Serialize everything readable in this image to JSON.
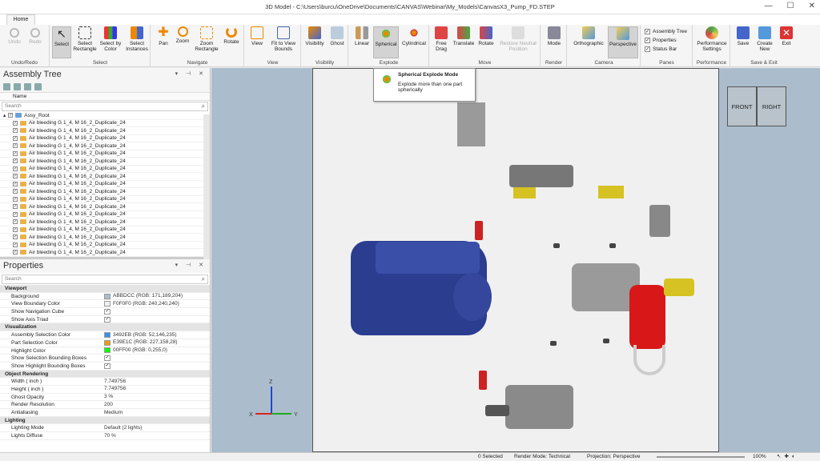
{
  "window": {
    "title": "3D Model - C:\\Users\\burcu\\OneDrive\\Documents\\CANVAS\\Webinar\\My_Models\\CanvasX3_Pump_FD.STEP"
  },
  "tab": "Home",
  "ribbon": {
    "undo": "Undo",
    "redo": "Redo",
    "undo_group": "Undo/Redo",
    "select": "Select",
    "select_rect": "Select Rectangle",
    "select_color": "Select by Color",
    "select_inst": "Select Instances",
    "select_group": "Select",
    "pan": "Pan",
    "zoom": "Zoom",
    "zoom_rect": "Zoom Rectangle",
    "rotate": "Rotate",
    "navigate_group": "Navigate",
    "view": "View",
    "fit": "Fit to View Bounds",
    "view_group": "View",
    "visibility": "Visibility",
    "ghost": "Ghost",
    "visibility_group": "Visibility",
    "linear": "Linear",
    "spherical": "Spherical",
    "cylindrical": "Cylindrical",
    "explode_group": "Explode",
    "free_drag": "Free Drag",
    "translate": "Translate",
    "rotate_move": "Rotate",
    "restore": "Restore Neutral Position",
    "move_group": "Move",
    "mode": "Mode",
    "render_group": "Render",
    "ortho": "Orthographic",
    "persp": "Perspective",
    "camera_group": "Camera",
    "assembly_tree": "Assembly Tree",
    "properties": "Properties",
    "status_bar": "Status Bar",
    "panes_group": "Panes",
    "perf": "Performance Settings",
    "perf_group": "Performance",
    "save": "Save",
    "create_new": "Create New",
    "exit": "Exit",
    "save_group": "Save & Exit"
  },
  "tooltip": {
    "title": "Spherical Explode Mode",
    "body": "Explode more than one part spherically"
  },
  "assembly": {
    "title": "Assembly Tree",
    "col_name": "Name",
    "search": "Search",
    "root": "Assy_Root",
    "item": "Air bleeding G 1_4, M 16_2_Duplicate_24"
  },
  "properties": {
    "title": "Properties",
    "search": "Search",
    "rows": [
      {
        "cat": true,
        "k": "Viewport",
        "v": ""
      },
      {
        "k": "Background",
        "v": "ABBDCC (RGB: 171,189,204)",
        "sw": "#abbdcc"
      },
      {
        "k": "View Boundary Color",
        "v": "F0F0F0 (RGB: 240,240,240)",
        "sw": "#f0f0f0"
      },
      {
        "k": "Show Navigation Cube",
        "v": "",
        "chk": true
      },
      {
        "k": "Show Axis Triad",
        "v": "",
        "chk": true
      },
      {
        "cat": true,
        "k": "Visualization",
        "v": ""
      },
      {
        "k": "Assembly Selection Color",
        "v": "3492EB (RGB: 52,146,235)",
        "sw": "#3492eb"
      },
      {
        "k": "Part Selection Color",
        "v": "E39E1C (RGB: 227,158,28)",
        "sw": "#e39e1c"
      },
      {
        "k": "Highlight Color",
        "v": "00FF00 (RGB: 0,255,0)",
        "sw": "#00ff00"
      },
      {
        "k": "Show Selection Bounding Boxes",
        "v": "",
        "chk": true
      },
      {
        "k": "Show Highlight Bounding Boxes",
        "v": "",
        "chk": true
      },
      {
        "cat": true,
        "k": "Object Rendering",
        "v": ""
      },
      {
        "k": "Width ( inch )",
        "v": "7.749756"
      },
      {
        "k": "Height ( inch )",
        "v": "7.749756"
      },
      {
        "k": "Ghost Opacity",
        "v": "3 %"
      },
      {
        "k": "Render Resolution",
        "v": "200"
      },
      {
        "k": "Antialiasing",
        "v": "Medium"
      },
      {
        "cat": true,
        "k": "Lighting",
        "v": ""
      },
      {
        "k": "Lighting Mode",
        "v": "Default (2 lights)"
      },
      {
        "k": "Lights Diffuse",
        "v": "70 %"
      }
    ]
  },
  "cube": {
    "front": "FRONT",
    "right": "RIGHT"
  },
  "triad": {
    "x": "X",
    "y": "Y",
    "z": "Z"
  },
  "status": {
    "selected": "0 Selected",
    "render_mode": "Render Mode: Technical",
    "projection": "Projection: Perspective",
    "zoom": "100%"
  }
}
